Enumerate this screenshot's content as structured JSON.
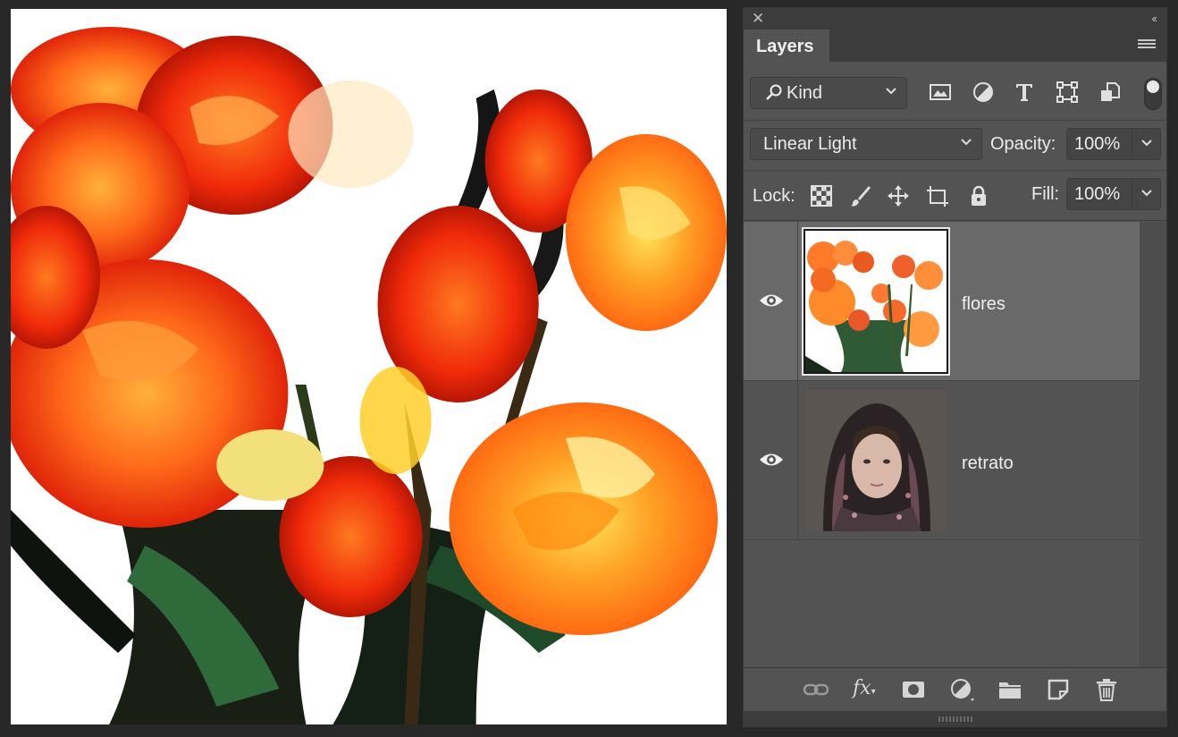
{
  "panel": {
    "close_icon": "close-icon",
    "collapse_icon": "double-chevron-left-icon",
    "tab_title": "Layers",
    "menu_icon": "panel-menu-icon"
  },
  "filter": {
    "kind_label": "Kind",
    "icons": [
      "pixel-layer-filter-icon",
      "adjustment-layer-filter-icon",
      "type-layer-filter-icon",
      "shape-layer-filter-icon",
      "smart-object-filter-icon"
    ],
    "toggle_on": true
  },
  "blend": {
    "mode": "Linear Light",
    "opacity_label": "Opacity:",
    "opacity_value": "100%"
  },
  "lock": {
    "label": "Lock:",
    "icons": [
      "lock-transparent-pixels-icon",
      "lock-image-pixels-icon",
      "lock-position-icon",
      "lock-artboard-icon",
      "lock-all-icon"
    ],
    "fill_label": "Fill:",
    "fill_value": "100%"
  },
  "layers": [
    {
      "name": "flores",
      "visible": true,
      "selected": true,
      "thumbnail": "roses-bouquet"
    },
    {
      "name": "retrato",
      "visible": true,
      "selected": false,
      "thumbnail": "woman-headscarf-portrait"
    }
  ],
  "bottom_toolbar": {
    "icons": [
      "link-layers-icon",
      "fx-layer-style-icon",
      "add-mask-icon",
      "new-adjustment-layer-icon",
      "new-group-icon",
      "new-layer-icon",
      "delete-layer-icon"
    ],
    "fx_label": "fx"
  },
  "canvas": {
    "description_colors": [
      "#ff5a1a",
      "#ff8c1a",
      "#ffd21a",
      "#1a1a1a",
      "#2e6b3a",
      "#ffffff"
    ]
  }
}
